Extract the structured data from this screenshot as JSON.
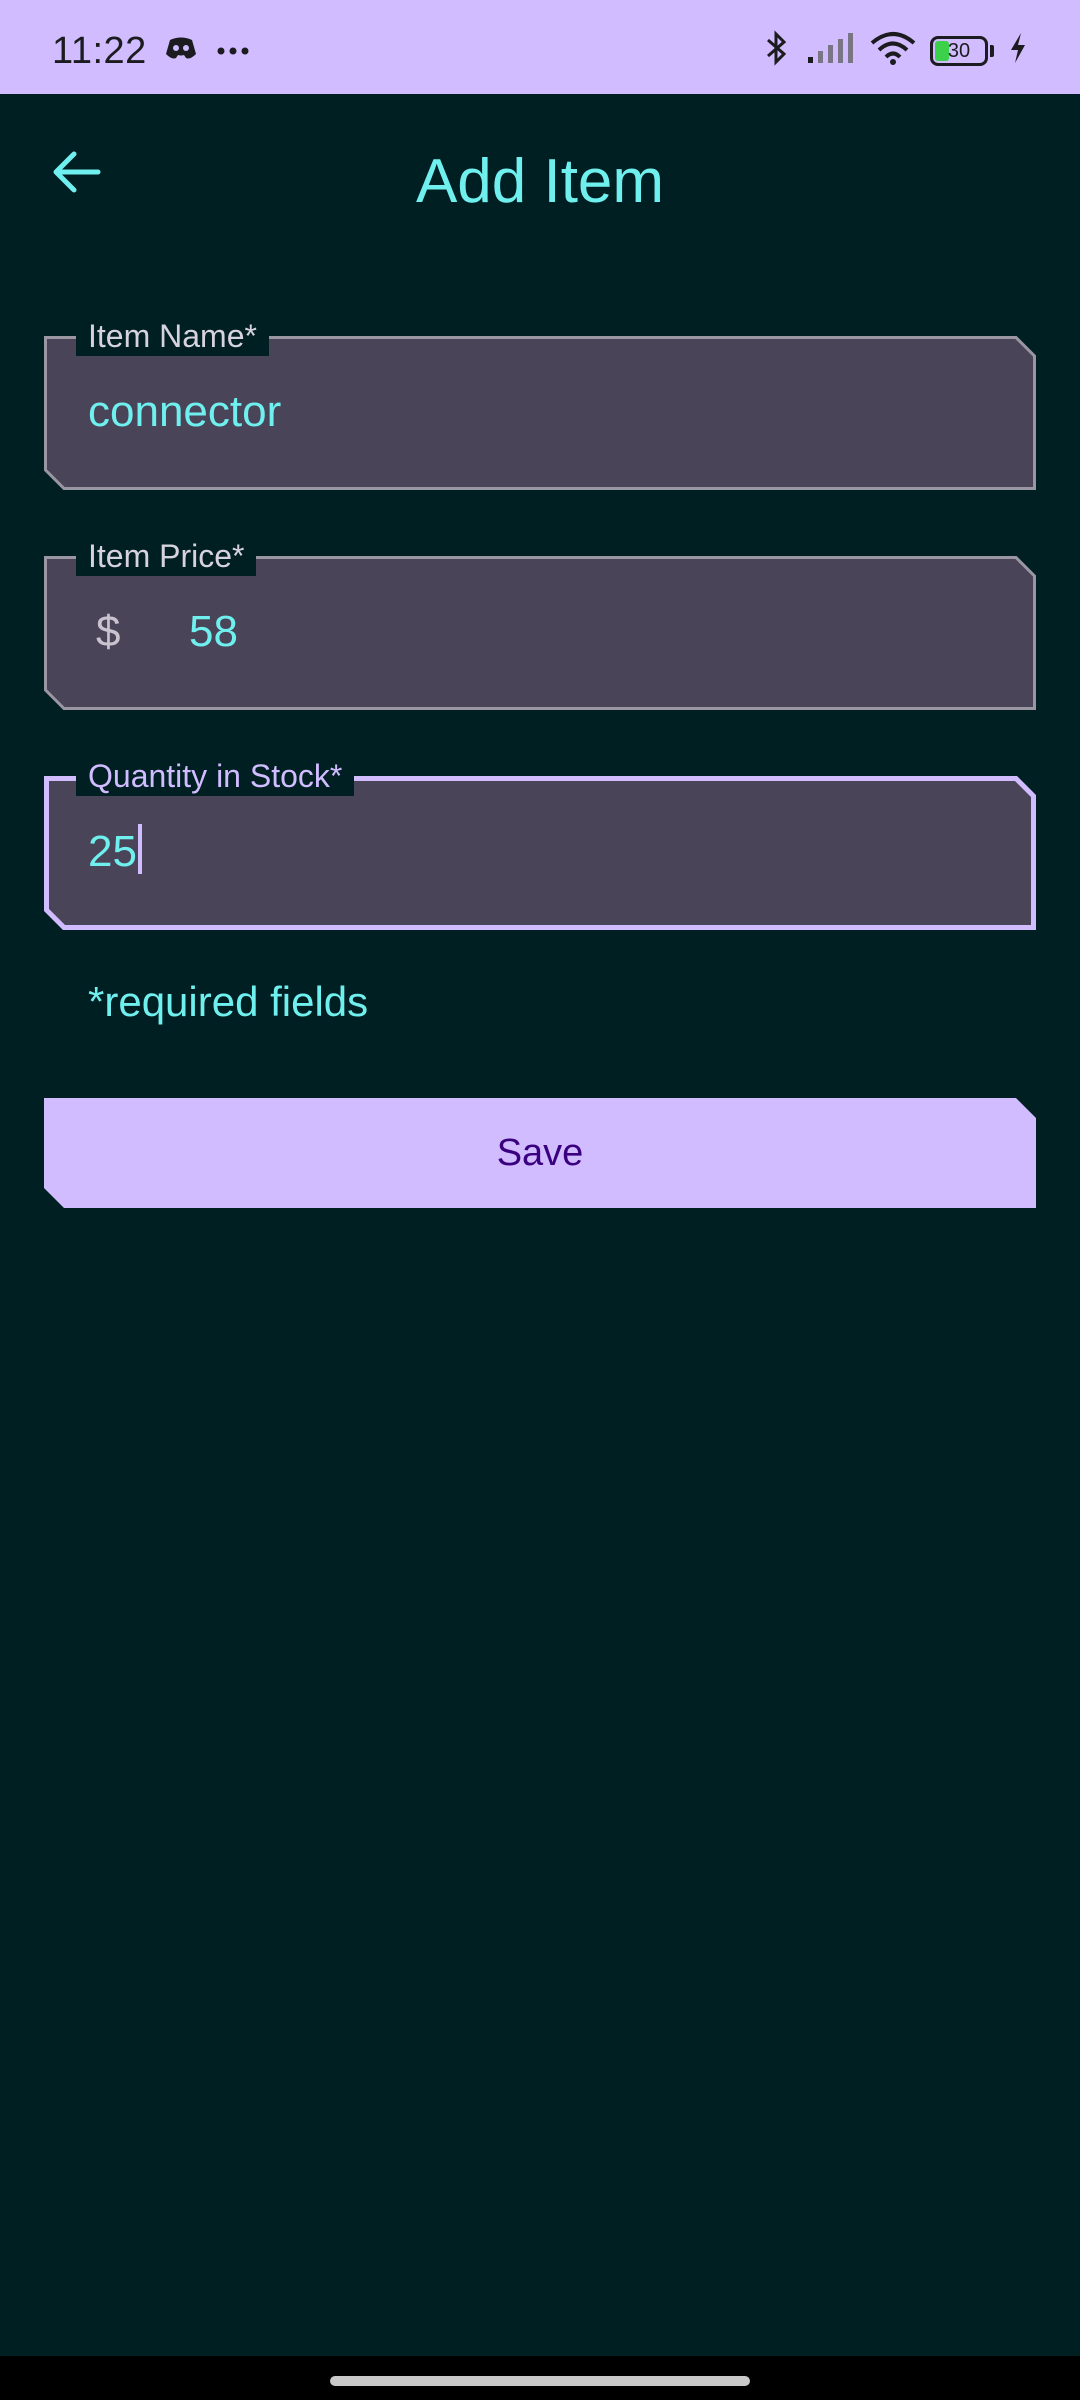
{
  "status_bar": {
    "time": "11:22",
    "left_icons": [
      "discord-icon",
      "more-dots-icon"
    ],
    "right_icons": [
      "bluetooth-icon",
      "signal-icon",
      "wifi-icon",
      "battery-icon",
      "charging-icon"
    ],
    "battery_level": "30",
    "battery_fraction": 0.3
  },
  "app_bar": {
    "title": "Add Item",
    "back_icon": "arrow-left-icon"
  },
  "form": {
    "item_name": {
      "label": "Item Name*",
      "value": "connector"
    },
    "item_price": {
      "label": "Item Price*",
      "prefix": "$",
      "value": "58"
    },
    "quantity": {
      "label": "Quantity in Stock*",
      "value": "25",
      "focused": true
    },
    "required_note": "*required fields",
    "save_label": "Save"
  },
  "colors": {
    "background": "#001f23",
    "status_bar": "#d0bcff",
    "accent_text": "#6ff0ef",
    "field_fill": "#4a4458",
    "field_border": "#9a96a2",
    "focused_border": "#d0bcff",
    "button_fill": "#d0bcff",
    "button_text": "#3a0080"
  }
}
